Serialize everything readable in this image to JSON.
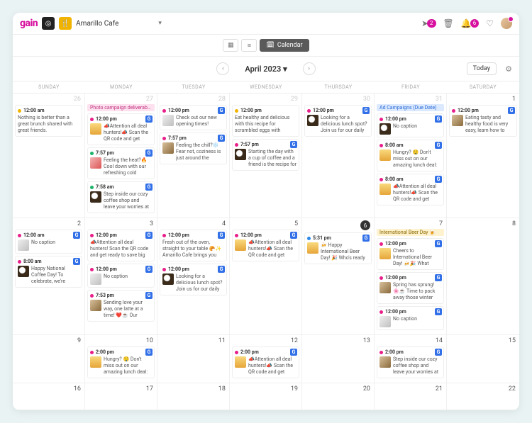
{
  "header": {
    "logo": "gain",
    "workspace": "Amarillo Cafe",
    "send_badge": "2",
    "bell_badge": "6"
  },
  "viewbar": {
    "calendar_label": "Calendar"
  },
  "nav": {
    "title": "April 2023",
    "today_label": "Today"
  },
  "dayHeaders": [
    "SUNDAY",
    "MONDAY",
    "TUESDAY",
    "WEDNESDAY",
    "THURSDAY",
    "FRIDAY",
    "SATURDAY"
  ],
  "weeks": [
    {
      "days": [
        {
          "n": "26",
          "muted": true,
          "events": [
            {
              "time": "12:00 am",
              "dot": "yellow",
              "g": false,
              "thumb": null,
              "text": "Nothing is better than a great brunch shared with great friends."
            }
          ]
        },
        {
          "n": "27",
          "muted": true,
          "chips": [
            {
              "cls": "pink",
              "label": "Photo campaign deliverables"
            }
          ],
          "events": [
            {
              "time": "12:00 pm",
              "dot": "pink",
              "g": true,
              "thumb": "c",
              "text": "📣Attention all deal hunters!📣 Scan the QR code and get ready to save big from Monday to"
            },
            {
              "time": "7:57 pm",
              "dot": "green",
              "g": true,
              "thumb": "e",
              "text": "Feeling the heat?🔥 Cool down with our refreshing cold"
            },
            {
              "time": "7:58 am",
              "dot": "green",
              "g": true,
              "thumb": "b",
              "text": "Step inside our cozy coffee shop and leave your worries at the"
            }
          ]
        },
        {
          "n": "28",
          "muted": true,
          "events": [
            {
              "time": "12:00 pm",
              "dot": "pink",
              "g": true,
              "thumb": "d",
              "text": "Check out our new opening times!"
            },
            {
              "time": "7:57 pm",
              "dot": "pink",
              "g": true,
              "thumb": "a",
              "text": "Feeling the chill?❄️ Fear not, coziness is just around the"
            }
          ]
        },
        {
          "n": "29",
          "muted": true,
          "events": [
            {
              "time": "12:00 pm",
              "dot": "yellow",
              "g": false,
              "thumb": null,
              "text": "Eat healthy and delicious with this recipe for scrambled eggs with tomato sauce 🍳🍅"
            },
            {
              "time": "7:57 pm",
              "dot": "pink",
              "g": true,
              "thumb": "b",
              "text": "Starting the day with a cup of coffee and a friend is the recipe for"
            }
          ]
        },
        {
          "n": "30",
          "muted": true,
          "events": [
            {
              "time": "12:00 pm",
              "dot": "pink",
              "g": true,
              "thumb": "b",
              "text": "Looking for a delicious lunch spot? Join us for our daily"
            }
          ]
        },
        {
          "n": "31",
          "muted": true,
          "chips": [
            {
              "cls": "blue",
              "label": "Ad Campaigns (Due Date)"
            }
          ],
          "events": [
            {
              "time": "12:00 pm",
              "dot": "pink",
              "g": true,
              "thumb": "b",
              "text": "No caption"
            },
            {
              "time": "8:00 am",
              "dot": "pink",
              "g": true,
              "thumb": "c",
              "text": "Hungry? 🤤 Don't miss out on our amazing lunch deal:"
            },
            {
              "time": "8:00 am",
              "dot": "pink",
              "g": true,
              "thumb": "c",
              "text": "📣Attention all deal hunters!📣 Scan the QR code and get"
            }
          ]
        },
        {
          "n": "1",
          "events": [
            {
              "time": "12:00 pm",
              "dot": "pink",
              "g": true,
              "thumb": "a",
              "text": "Eating tasty and healthy food is very easy, learn how to"
            }
          ]
        }
      ]
    },
    {
      "days": [
        {
          "n": "2",
          "events": [
            {
              "time": "12:00 am",
              "dot": "pink",
              "g": true,
              "thumb": "d",
              "text": "No caption"
            },
            {
              "time": "8:00 am",
              "dot": "pink",
              "g": true,
              "thumb": "b",
              "text": "Happy National Coffee Day! To celebrate, we're"
            }
          ]
        },
        {
          "n": "3",
          "events": [
            {
              "time": "12:00 pm",
              "dot": "pink",
              "g": true,
              "thumb": null,
              "text": "📣Attention all deal hunters! Scan the QR code and get ready to save big from Monday to"
            },
            {
              "time": "12:00 pm",
              "dot": "pink",
              "g": true,
              "thumb": "d",
              "text": "No caption"
            },
            {
              "time": "7:53 pm",
              "dot": "pink",
              "g": true,
              "thumb": "a",
              "text": "Sending love your way, one latte at a time! ❤️☕ Our"
            }
          ]
        },
        {
          "n": "4",
          "events": [
            {
              "time": "12:00 pm",
              "dot": "pink",
              "g": true,
              "thumb": null,
              "text": "Fresh out of the oven, straight to your table 🥐✨ Amarillo Cafe brings you the finest selection"
            },
            {
              "time": "12:00 pm",
              "dot": "pink",
              "g": true,
              "thumb": "b",
              "text": "Looking for a delicious lunch spot? Join us for our daily"
            }
          ]
        },
        {
          "n": "5",
          "events": [
            {
              "time": "12:00 pm",
              "dot": "pink",
              "g": true,
              "thumb": "c",
              "text": "📣Attention all deal hunters!📣 Scan the QR code and get"
            }
          ]
        },
        {
          "n": "6",
          "circle": true,
          "events": [
            {
              "time": "5:31 pm",
              "dot": "blue",
              "g": true,
              "thumb": "c",
              "text": "🍻 Happy International Beer Day! 🎉 Who's ready"
            }
          ]
        },
        {
          "n": "7",
          "chips": [
            {
              "cls": "yellow",
              "label": "International Beer Day 🍺"
            }
          ],
          "events": [
            {
              "time": "12:00 pm",
              "dot": "pink",
              "g": true,
              "thumb": "c",
              "text": "Cheers to International Beer Day! 🍻🎉 What"
            },
            {
              "time": "12:00 pm",
              "dot": "pink",
              "g": true,
              "thumb": "a",
              "text": "Spring has sprung! 🌸☕ Time to pack away those winter"
            },
            {
              "time": "12:00 pm",
              "dot": "pink",
              "g": true,
              "thumb": "d",
              "text": "No caption"
            }
          ]
        },
        {
          "n": "8",
          "events": []
        }
      ]
    },
    {
      "days": [
        {
          "n": "9",
          "events": []
        },
        {
          "n": "10",
          "events": [
            {
              "time": "2:00 pm",
              "dot": "pink",
              "g": true,
              "thumb": "c",
              "text": "Hungry? 🤤 Don't miss out on our amazing lunch deal:"
            }
          ]
        },
        {
          "n": "11",
          "events": []
        },
        {
          "n": "12",
          "events": [
            {
              "time": "2:00 pm",
              "dot": "pink",
              "g": true,
              "thumb": "c",
              "text": "📣Attention all deal hunters!📣 Scan the QR code and get"
            }
          ]
        },
        {
          "n": "13",
          "events": []
        },
        {
          "n": "14",
          "events": [
            {
              "time": "2:00 pm",
              "dot": "pink",
              "g": true,
              "thumb": "a",
              "text": "Step inside our cozy coffee shop and leave your worries at the"
            }
          ]
        },
        {
          "n": "15",
          "events": []
        }
      ]
    },
    {
      "days": [
        {
          "n": "16",
          "events": []
        },
        {
          "n": "17",
          "events": []
        },
        {
          "n": "18",
          "events": []
        },
        {
          "n": "19",
          "events": []
        },
        {
          "n": "20",
          "events": []
        },
        {
          "n": "21",
          "events": []
        },
        {
          "n": "22",
          "events": []
        }
      ]
    }
  ]
}
